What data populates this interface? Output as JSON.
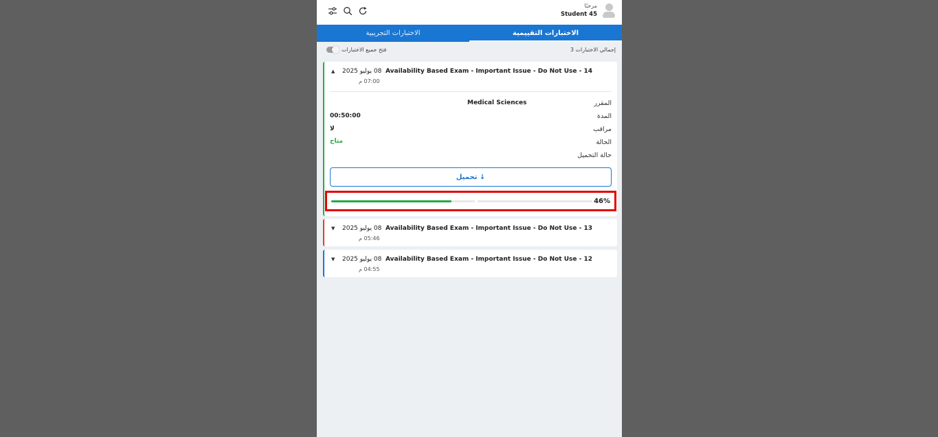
{
  "header": {
    "greeting": "مرحبًا",
    "username": "Student 45",
    "icons": [
      "filter-sliders-icon",
      "search-icon",
      "refresh-icon"
    ]
  },
  "tabs": [
    {
      "label": "الاختبارات التقييمية",
      "active": true
    },
    {
      "label": "الاختبارات التجريبية",
      "active": false
    }
  ],
  "summary": {
    "total_label": "إجمالي الاختبارات 3",
    "expand_all_label": "فتح جميع الاختبارات"
  },
  "exams": [
    {
      "title": "Availability Based Exam - Important Issue - Do Not Use - 14",
      "date": "08 يوليو 2025",
      "time": "07:00 م",
      "expanded": true,
      "accent": "#2aa84a",
      "details": {
        "course_label": "المقرر",
        "course_value": "Medical Sciences",
        "duration_label": "المدة",
        "duration_value": "00:50:00",
        "proctored_label": "مراقب",
        "proctored_value": "لا",
        "status_label": "الحالة",
        "status_value": "متاح",
        "download_status_label": "حالة التحميل"
      },
      "download_button": "↓ تحميل",
      "progress_percent": 46,
      "progress_label": "46%"
    },
    {
      "title": "Availability Based Exam - Important Issue - Do Not Use - 13",
      "date": "08 يوليو 2025",
      "time": "05:46 م",
      "expanded": false,
      "accent": "#e53935"
    },
    {
      "title": "Availability Based Exam - Important Issue - Do Not Use - 12",
      "date": "08 يوليو 2025",
      "time": "04:55 م",
      "expanded": false,
      "accent": "#1976d2"
    }
  ],
  "colors": {
    "primary": "#1976d2",
    "success": "#2aa84a",
    "highlight": "#e00000",
    "backdrop": "#5f5f5f",
    "panel_bg": "#ecf0f3"
  }
}
